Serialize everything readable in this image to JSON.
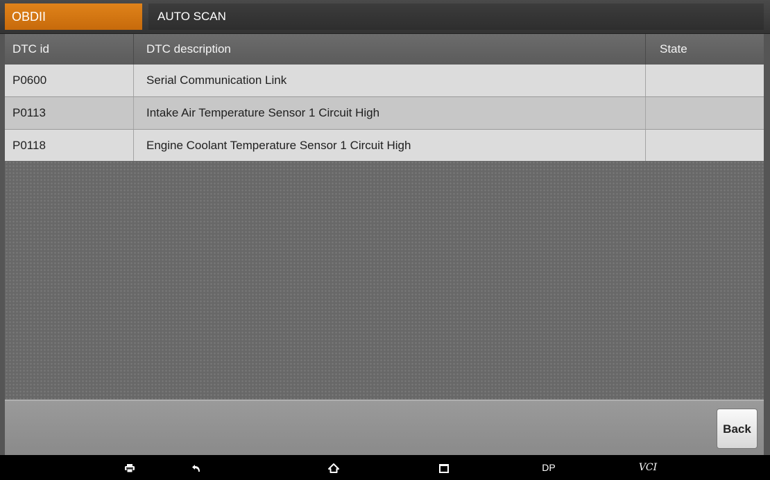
{
  "tabs": {
    "active": "OBDII",
    "title": "AUTO SCAN"
  },
  "table": {
    "columns": [
      "DTC id",
      "DTC description",
      "State"
    ],
    "rows": [
      {
        "id": "P0600",
        "description": "Serial Communication Link",
        "state": ""
      },
      {
        "id": "P0113",
        "description": "Intake Air Temperature Sensor 1 Circuit High",
        "state": ""
      },
      {
        "id": "P0118",
        "description": "Engine Coolant Temperature Sensor 1 Circuit High",
        "state": ""
      }
    ]
  },
  "footer": {
    "back_label": "Back"
  },
  "navbar": {
    "items": [
      {
        "icon": "printer-icon"
      },
      {
        "icon": "back-arrow-icon"
      },
      {
        "icon": "home-icon"
      },
      {
        "icon": "recent-apps-icon"
      },
      {
        "label": "DP"
      },
      {
        "label": "VCI"
      }
    ]
  },
  "colors": {
    "accent": "#d97812",
    "header_bg": "#606060",
    "row_light": "#dcdcdc",
    "row_dark": "#c7c7c7"
  }
}
